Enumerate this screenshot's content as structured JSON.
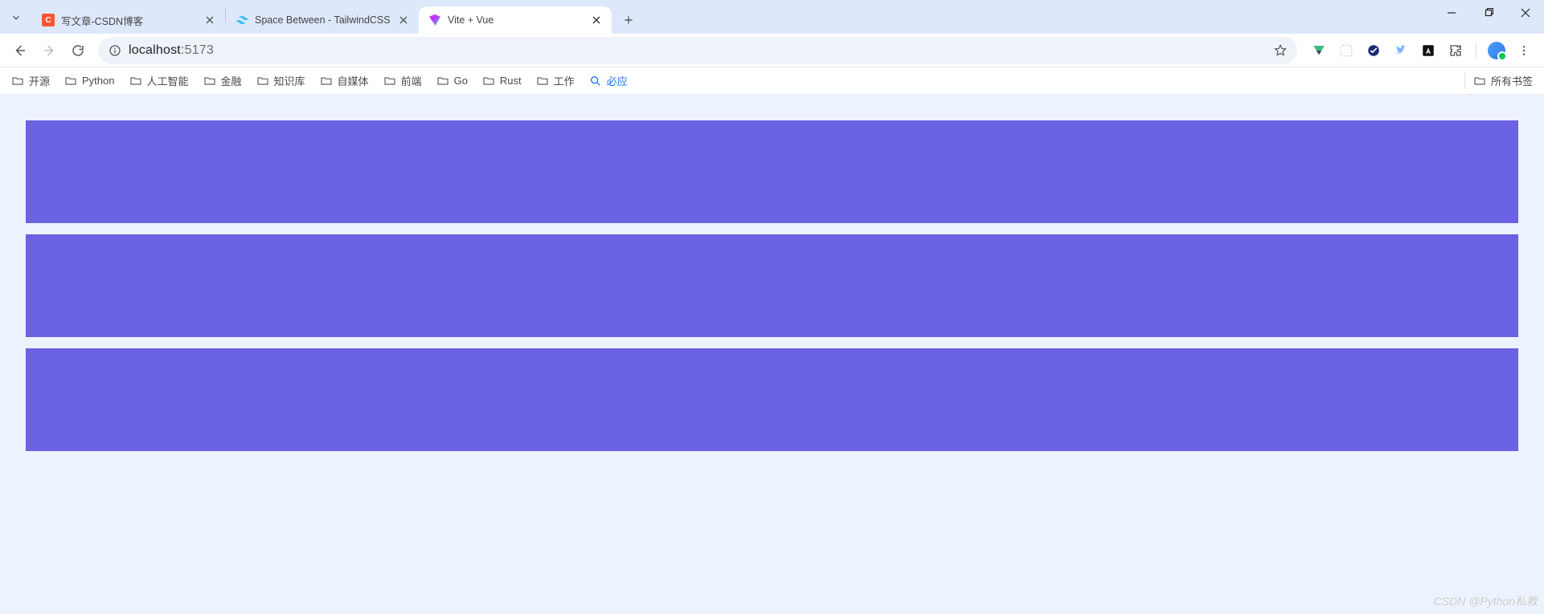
{
  "titlebar": {
    "tabs": [
      {
        "title": "写文章-CSDN博客"
      },
      {
        "title": "Space Between - TailwindCSS"
      },
      {
        "title": "Vite + Vue"
      }
    ]
  },
  "toolbar": {
    "url_host": "localhost",
    "url_port": ":5173"
  },
  "bookmarks": {
    "items": [
      "开源",
      "Python",
      "人工智能",
      "金融",
      "知识库",
      "自媒体",
      "前端",
      "Go",
      "Rust",
      "工作"
    ],
    "search_label": "必应",
    "all_label": "所有书签"
  },
  "watermark": "CSDN @Python私教"
}
